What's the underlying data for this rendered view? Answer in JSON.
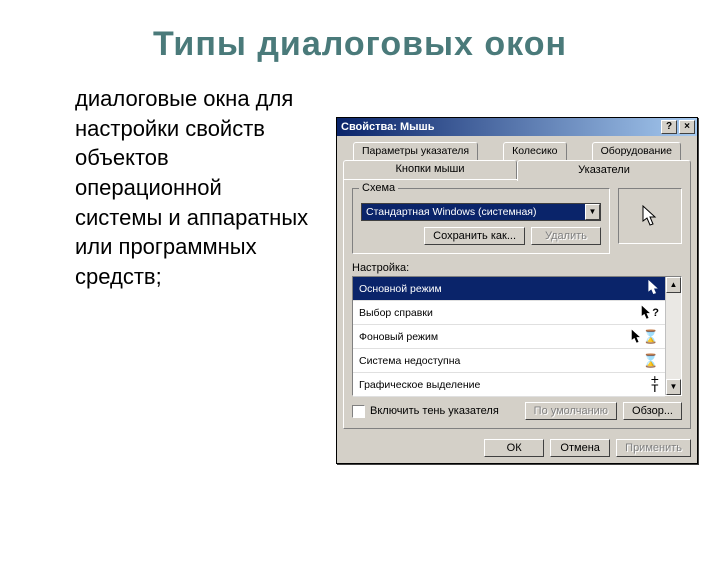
{
  "slide": {
    "title": "Типы диалоговых окон",
    "body": "диалоговые окна для настройки свойств объектов операционной системы и аппаратных или программных средств;"
  },
  "dialog": {
    "title": "Свойства: Мышь",
    "help_btn": "?",
    "close_btn": "×",
    "tabs_back": [
      "Параметры указателя",
      "Колесико",
      "Оборудование"
    ],
    "tabs_front": [
      "Кнопки мыши",
      "Указатели"
    ],
    "active_tab": "Указатели",
    "scheme": {
      "group_label": "Схема",
      "selected": "Стандартная Windows (системная)",
      "save_as": "Сохранить как...",
      "delete": "Удалить"
    },
    "settings": {
      "label": "Настройка:",
      "items": [
        {
          "name": "Основной режим",
          "icon": "arrow",
          "selected": true
        },
        {
          "name": "Выбор справки",
          "icon": "arrow-q"
        },
        {
          "name": "Фоновый режим",
          "icon": "arrow-hg"
        },
        {
          "name": "Система недоступна",
          "icon": "hourglass"
        },
        {
          "name": "Графическое выделение",
          "icon": "crosshair"
        }
      ]
    },
    "shadow_checkbox": "Включить тень указателя",
    "default_btn": "По умолчанию",
    "browse_btn": "Обзор...",
    "ok": "ОК",
    "cancel": "Отмена",
    "apply": "Применить"
  }
}
